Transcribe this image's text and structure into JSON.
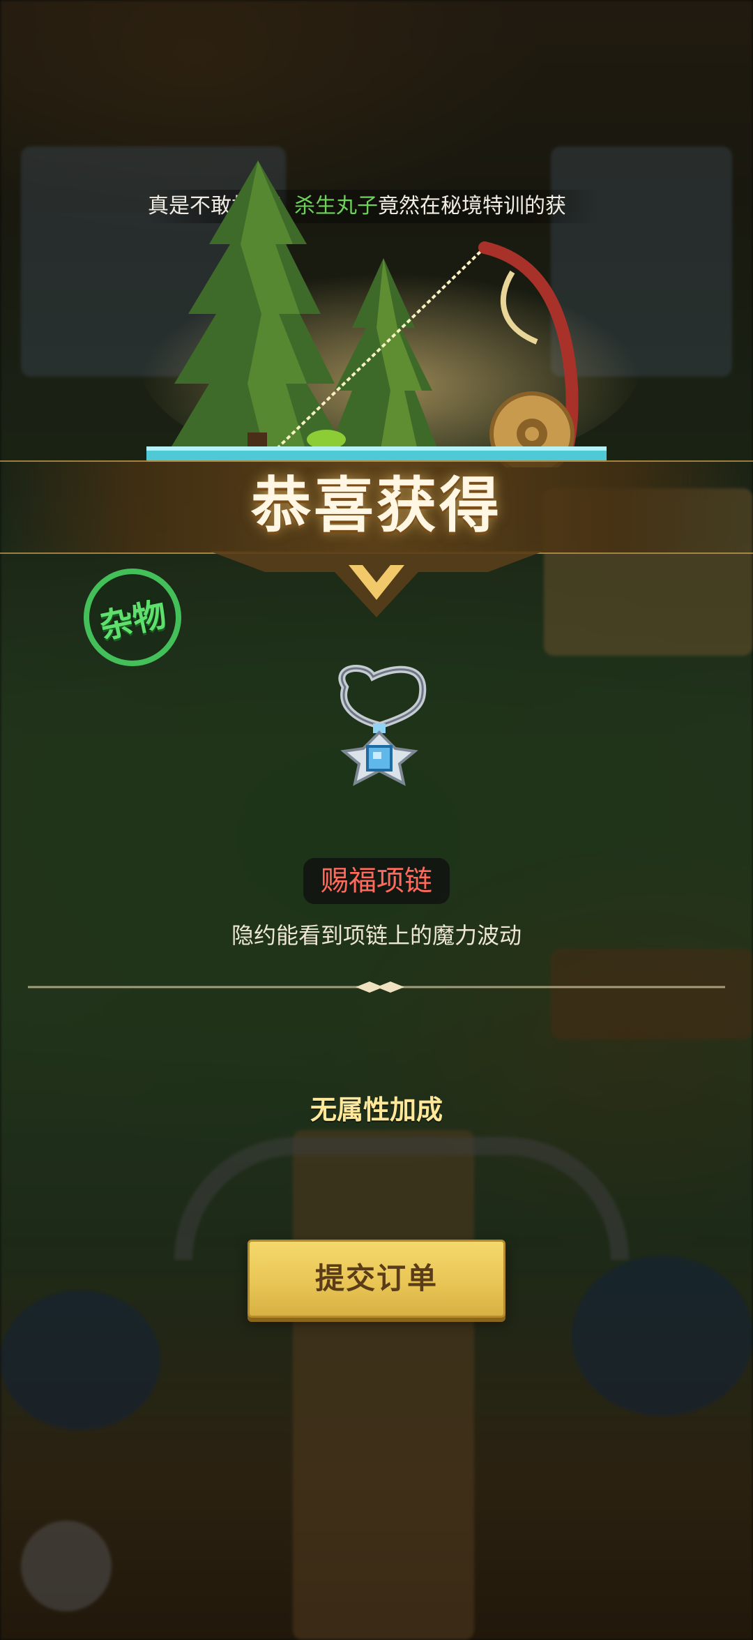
{
  "ticker": {
    "prefix": "真是不敢相信！",
    "highlight": "杀生丸子",
    "suffix": "竟然在秘境特训的获"
  },
  "reward": {
    "title": "恭喜获得",
    "category_badge": "杂物",
    "item_name": "赐福项链",
    "item_description": "隐约能看到项链上的魔力波动",
    "attribute_text": "无属性加成"
  },
  "actions": {
    "submit_label": "提交订单"
  },
  "icons": {
    "item": "pendant-necklace-icon",
    "scene_trees": "pine-tree-icon",
    "scene_rod": "fishing-rod-icon"
  },
  "colors": {
    "title_text": "#fff7e3",
    "badge": "#44c05a",
    "item_name": "#ff6a5c",
    "attribute": "#ffe89a",
    "button": "#e9c656",
    "highlight": "#6ed35a"
  }
}
